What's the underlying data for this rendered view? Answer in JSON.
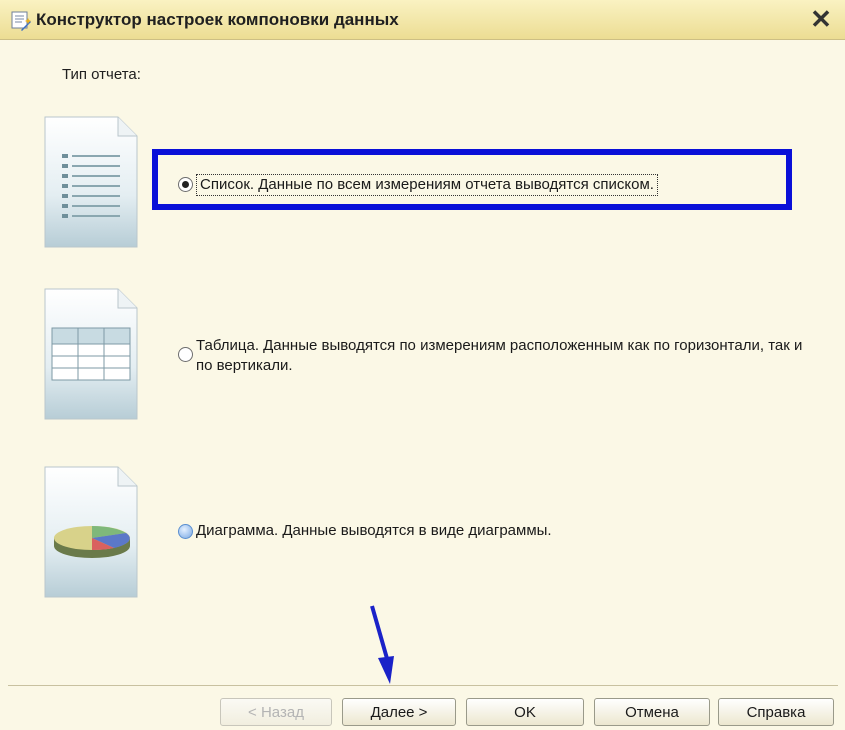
{
  "window": {
    "title": "Конструктор настроек компоновки данных",
    "close_symbol": "✕",
    "icon": "wizard-icon"
  },
  "report_type": {
    "label": "Тип отчета:",
    "options": [
      {
        "label": "Список. Данные по всем измерениям отчета выводятся списком.",
        "selected": true,
        "icon": "list-document-icon"
      },
      {
        "label": "Таблица. Данные выводятся по измерениям расположенным как по горизонтали, так и по вертикали.",
        "selected": false,
        "icon": "table-document-icon"
      },
      {
        "label": "Диаграмма. Данные выводятся в виде диаграммы.",
        "selected": false,
        "icon": "chart-document-icon"
      }
    ]
  },
  "buttons": {
    "back": "< Назад",
    "next": "Далее >",
    "ok": "OK",
    "cancel": "Отмена",
    "help": "Справка"
  },
  "colors": {
    "highlight": "#0a10d8",
    "arrow": "#1a22c8",
    "background": "#fbf8e6"
  }
}
